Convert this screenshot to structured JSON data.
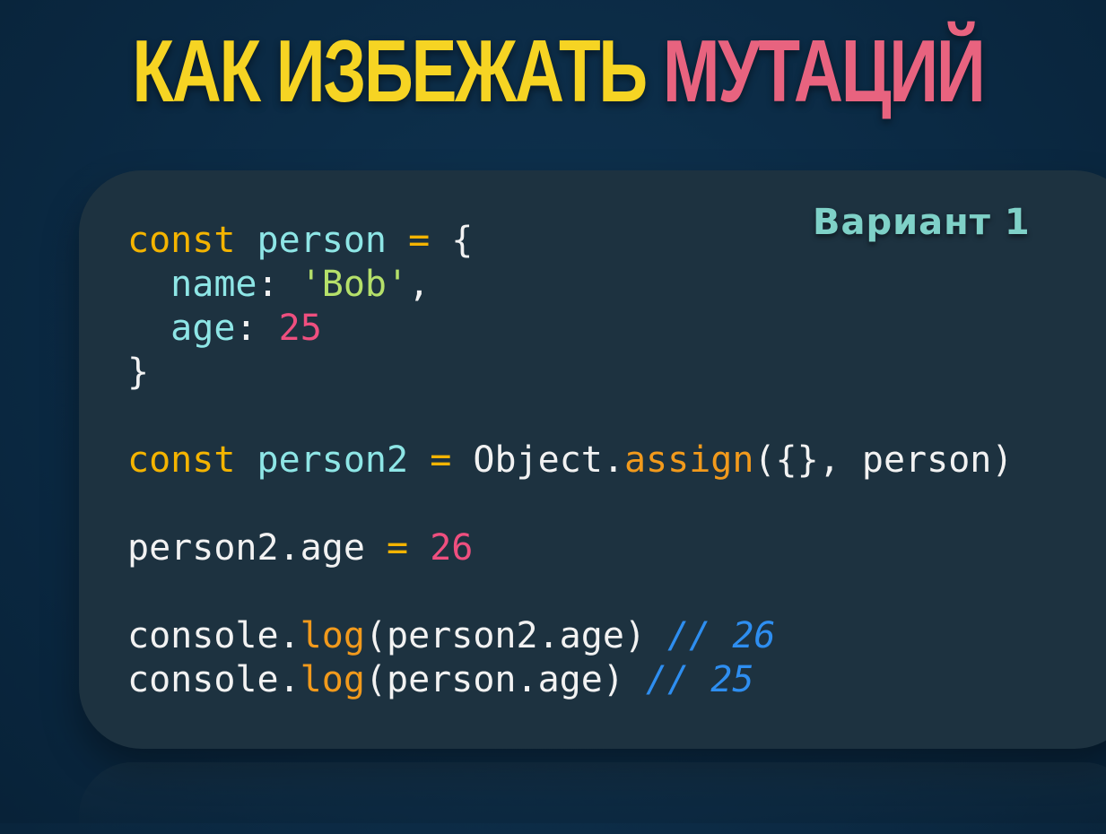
{
  "title": {
    "part1": "КАК ИЗБЕЖАТЬ",
    "part2": "МУТАЦИЙ"
  },
  "variant_label": "Вариант 1",
  "colors": {
    "background": "#0b2a44",
    "panel": "#1d3240",
    "title_yellow": "#f6d423",
    "title_pink": "#e8637f",
    "keyword": "#f4b400",
    "variable": "#8ee6e6",
    "string": "#b5e06a",
    "number": "#ef4f7f",
    "function": "#f29a1c",
    "comment": "#2e8ef0"
  },
  "code": {
    "line1": {
      "kw": "const",
      "var": "person",
      "op": "=",
      "brace": "{"
    },
    "line2": {
      "key": "name",
      "colon": ":",
      "str": "'Bob'",
      "comma": ","
    },
    "line3": {
      "key": "age",
      "colon": ":",
      "num": "25"
    },
    "line4": {
      "brace": "}"
    },
    "line6": {
      "kw": "const",
      "var": "person2",
      "op": "=",
      "obj": "Object",
      "dot": ".",
      "fn": "assign",
      "args": "({}, person)"
    },
    "line8": {
      "target": "person2.age",
      "op": "=",
      "num": "26"
    },
    "line10": {
      "obj": "console",
      "dot": ".",
      "fn": "log",
      "args": "(person2.age)",
      "cmt": "// 26"
    },
    "line11": {
      "obj": "console",
      "dot": ".",
      "fn": "log",
      "args": "(person.age)",
      "cmt": "// 25"
    }
  }
}
